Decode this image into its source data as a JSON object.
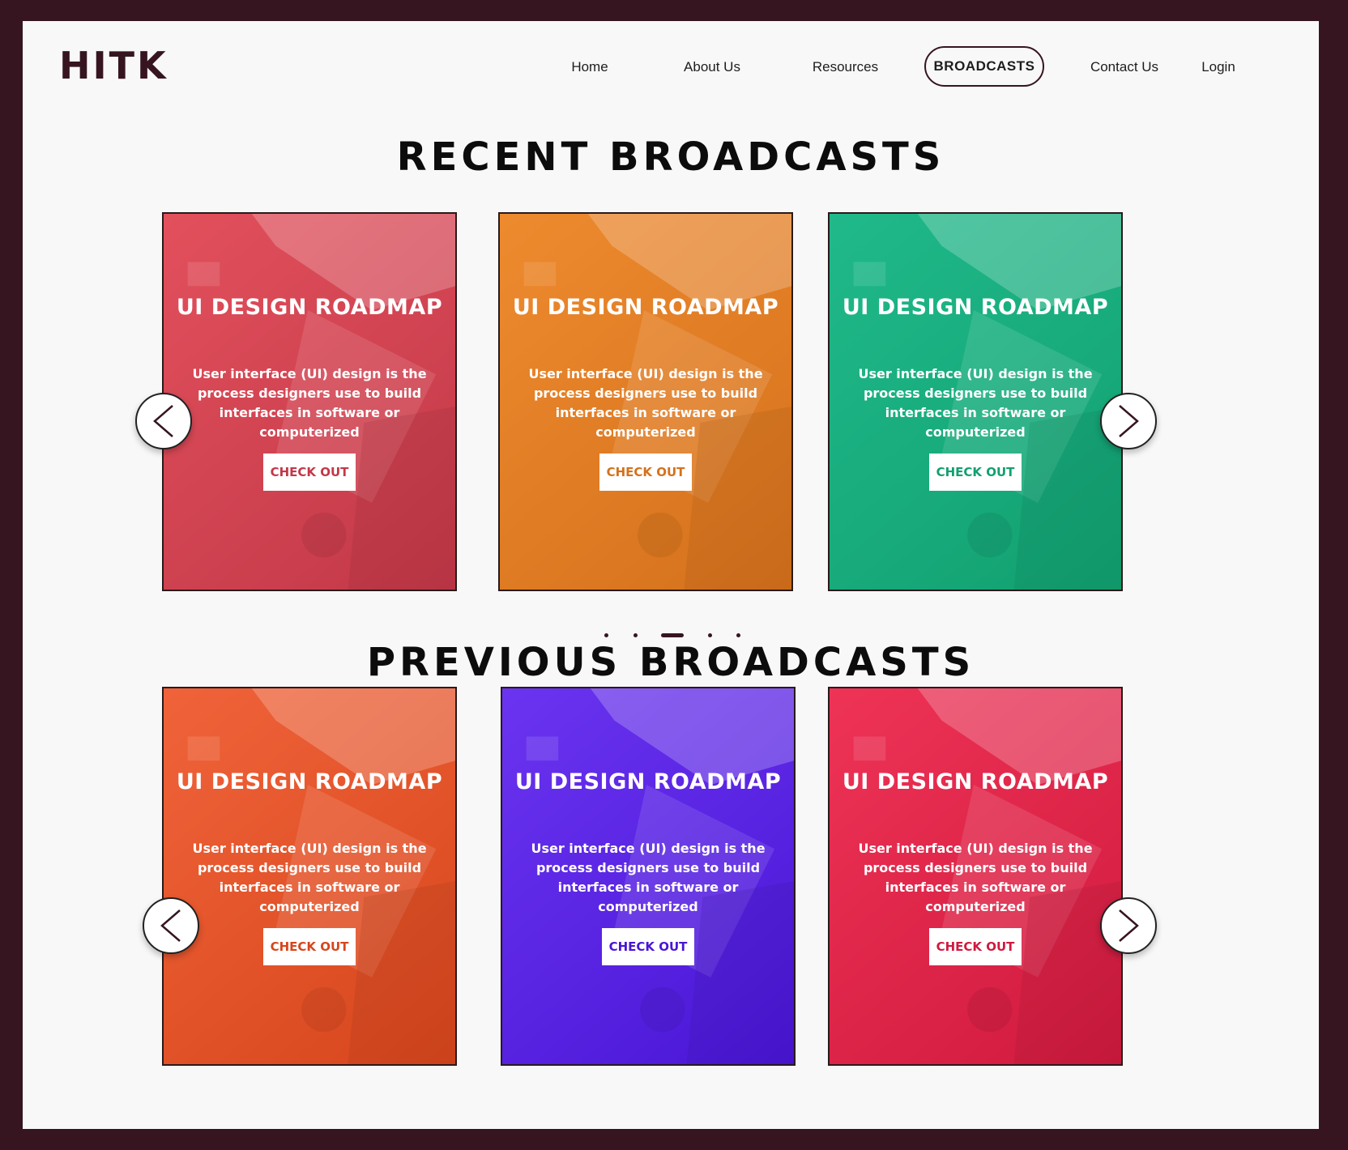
{
  "header": {
    "logo": "HITK",
    "nav": [
      {
        "label": "Home"
      },
      {
        "label": "About Us"
      },
      {
        "label": "Resources"
      },
      {
        "label": "BROADCASTS",
        "active": true
      },
      {
        "label": "Contact Us"
      },
      {
        "label": "Login"
      }
    ]
  },
  "recent": {
    "title": "RECENT BROADCASTS",
    "cards": [
      {
        "title": "UI DESIGN ROADMAP",
        "description": "User interface (UI) design is the process designers use to build interfaces in software or computerized",
        "button": "CHECK OUT",
        "color": "#e2505c",
        "color2": "#c23848"
      },
      {
        "title": "UI DESIGN ROADMAP",
        "description": "User interface (UI) design is the process designers use to build interfaces in software or computerized",
        "button": "CHECK OUT",
        "color": "#ee8a2e",
        "color2": "#d4711c"
      },
      {
        "title": "UI DESIGN ROADMAP",
        "description": "User interface (UI) design is the process designers use to build interfaces in software or computerized",
        "button": "CHECK OUT",
        "color": "#20b98a",
        "color2": "#12a070"
      }
    ]
  },
  "carousel_dots": {
    "count": 5,
    "active_index": 2
  },
  "previous": {
    "title": "PREVIOUS BROADCASTS",
    "cards": [
      {
        "title": "UI DESIGN ROADMAP",
        "description": "User interface (UI) design is the process designers use to build interfaces in software or computerized",
        "button": "CHECK OUT",
        "color": "#f0633a",
        "color2": "#d7461c"
      },
      {
        "title": "UI DESIGN ROADMAP",
        "description": "User interface (UI) design is the process designers use to build interfaces in software or computerized",
        "button": "CHECK OUT",
        "color": "#6a34f0",
        "color2": "#4a16d6"
      },
      {
        "title": "UI DESIGN ROADMAP",
        "description": "User interface (UI) design is the process designers use to build interfaces in software or computerized",
        "button": "CHECK OUT",
        "color": "#ee3356",
        "color2": "#d01a3e"
      }
    ]
  },
  "icons": {
    "prev": "chevron-left-icon",
    "next": "chevron-right-icon"
  }
}
